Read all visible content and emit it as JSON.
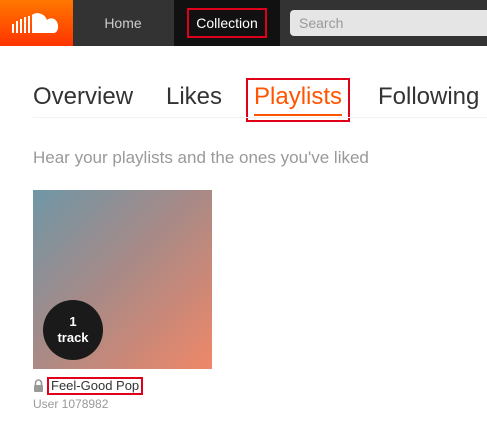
{
  "header": {
    "logo_icon": "soundcloud-cloud-icon",
    "nav": {
      "home_label": "Home",
      "collection_label": "Collection"
    },
    "search": {
      "placeholder": "Search",
      "value": ""
    }
  },
  "tabs": {
    "overview": "Overview",
    "likes": "Likes",
    "playlists": "Playlists",
    "following": "Following",
    "active": "Playlists"
  },
  "subtitle": "Hear your playlists and the ones you've liked",
  "playlists": [
    {
      "track_count": "1",
      "track_unit": "track",
      "title": "Feel-Good Pop",
      "user": "User 1078982",
      "private_icon": "lock-icon"
    }
  ],
  "colors": {
    "brand": "#ff5500",
    "header_bg": "#333333",
    "highlight_border": "#e0001b"
  }
}
